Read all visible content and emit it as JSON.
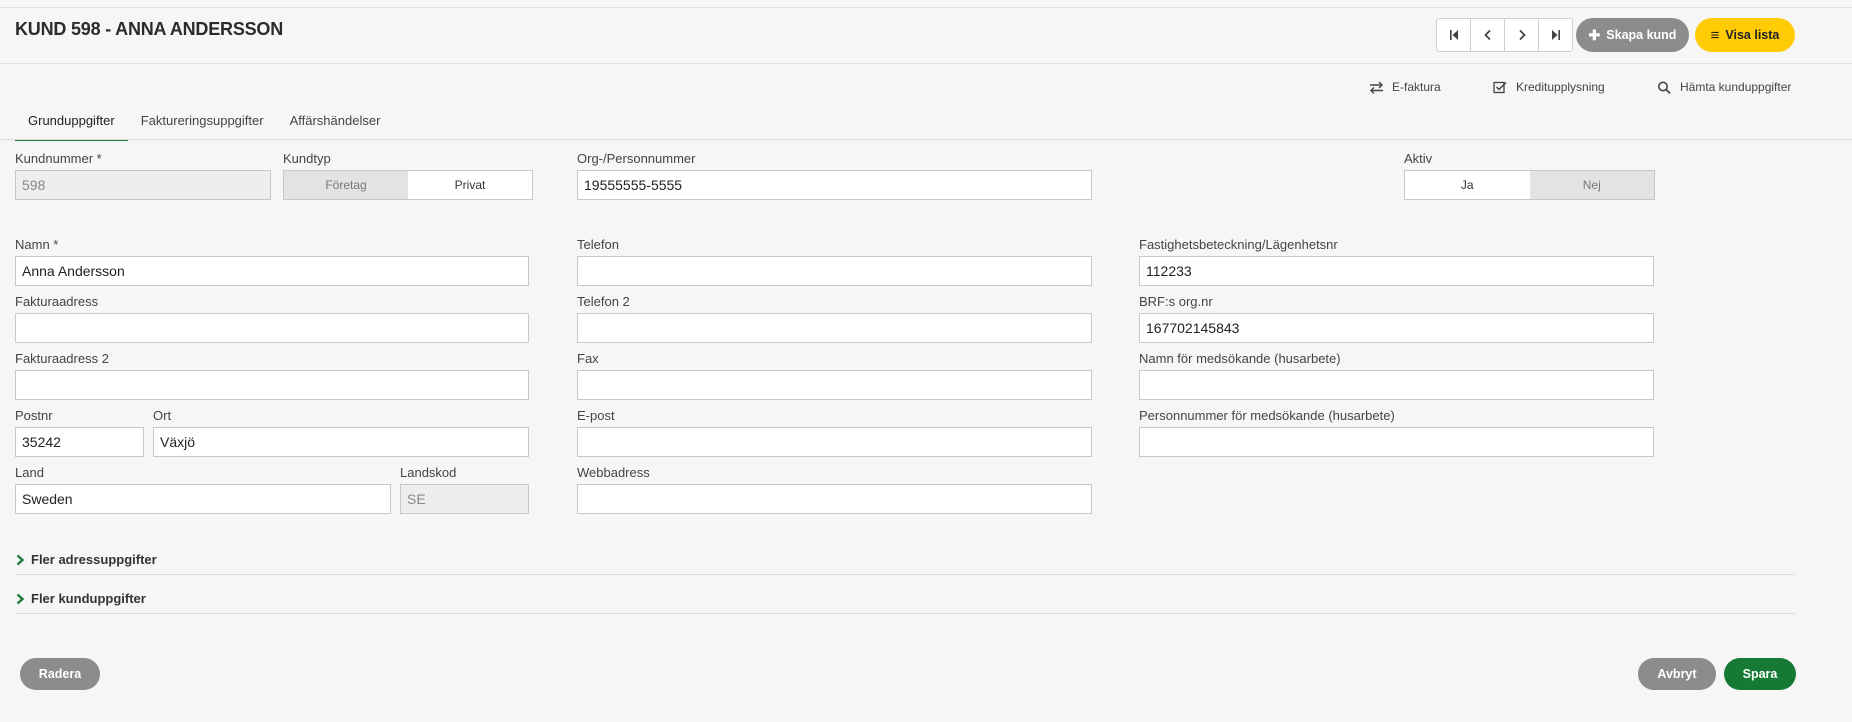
{
  "header": {
    "title": "KUND 598 - ANNA ANDERSSON",
    "create_label": "Skapa kund",
    "list_label": "Visa lista"
  },
  "quick_actions": {
    "efaktura": "E-faktura",
    "kredit": "Kreditupplysning",
    "hamta": "Hämta kunduppgifter"
  },
  "tabs": [
    {
      "label": "Grunduppgifter"
    },
    {
      "label": "Faktureringsuppgifter"
    },
    {
      "label": "Affärshändelser"
    }
  ],
  "form": {
    "kundnummer": {
      "label": "Kundnummer *",
      "value": "598"
    },
    "kundtyp": {
      "label": "Kundtyp",
      "options": [
        "Företag",
        "Privat"
      ],
      "selected": "Privat"
    },
    "orgnr": {
      "label": "Org-/Personnummer",
      "value": "19555555-5555"
    },
    "aktiv": {
      "label": "Aktiv",
      "options": [
        "Ja",
        "Nej"
      ],
      "selected": "Ja"
    },
    "namn": {
      "label": "Namn *",
      "value": "Anna Andersson"
    },
    "fakturaadress": {
      "label": "Fakturaadress",
      "value": ""
    },
    "fakturaadress2": {
      "label": "Fakturaadress 2",
      "value": ""
    },
    "postnr": {
      "label": "Postnr",
      "value": "35242"
    },
    "ort": {
      "label": "Ort",
      "value": "Växjö"
    },
    "land": {
      "label": "Land",
      "value": "Sweden"
    },
    "landskod": {
      "label": "Landskod",
      "value": "SE"
    },
    "telefon": {
      "label": "Telefon",
      "value": ""
    },
    "telefon2": {
      "label": "Telefon 2",
      "value": ""
    },
    "fax": {
      "label": "Fax",
      "value": ""
    },
    "epost": {
      "label": "E-post",
      "value": ""
    },
    "webbadress": {
      "label": "Webbadress",
      "value": ""
    },
    "fastighet": {
      "label": "Fastighetsbeteckning/Lägenhetsnr",
      "value": "112233"
    },
    "brf": {
      "label": "BRF:s org.nr",
      "value": "167702145843"
    },
    "medsokande_namn": {
      "label": "Namn för medsökande (husarbete)",
      "value": ""
    },
    "medsokande_pnr": {
      "label": "Personnummer för medsökande (husarbete)",
      "value": ""
    }
  },
  "sections": {
    "adress": "Fler adressuppgifter",
    "kund": "Fler kunduppgifter"
  },
  "footer": {
    "delete_label": "Radera",
    "cancel_label": "Avbryt",
    "save_label": "Spara"
  },
  "colors": {
    "accent_green": "#1f7a3d",
    "save_green": "#167a35",
    "list_yellow": "#ffcb05",
    "neutral_button": "#8c8c8c"
  }
}
